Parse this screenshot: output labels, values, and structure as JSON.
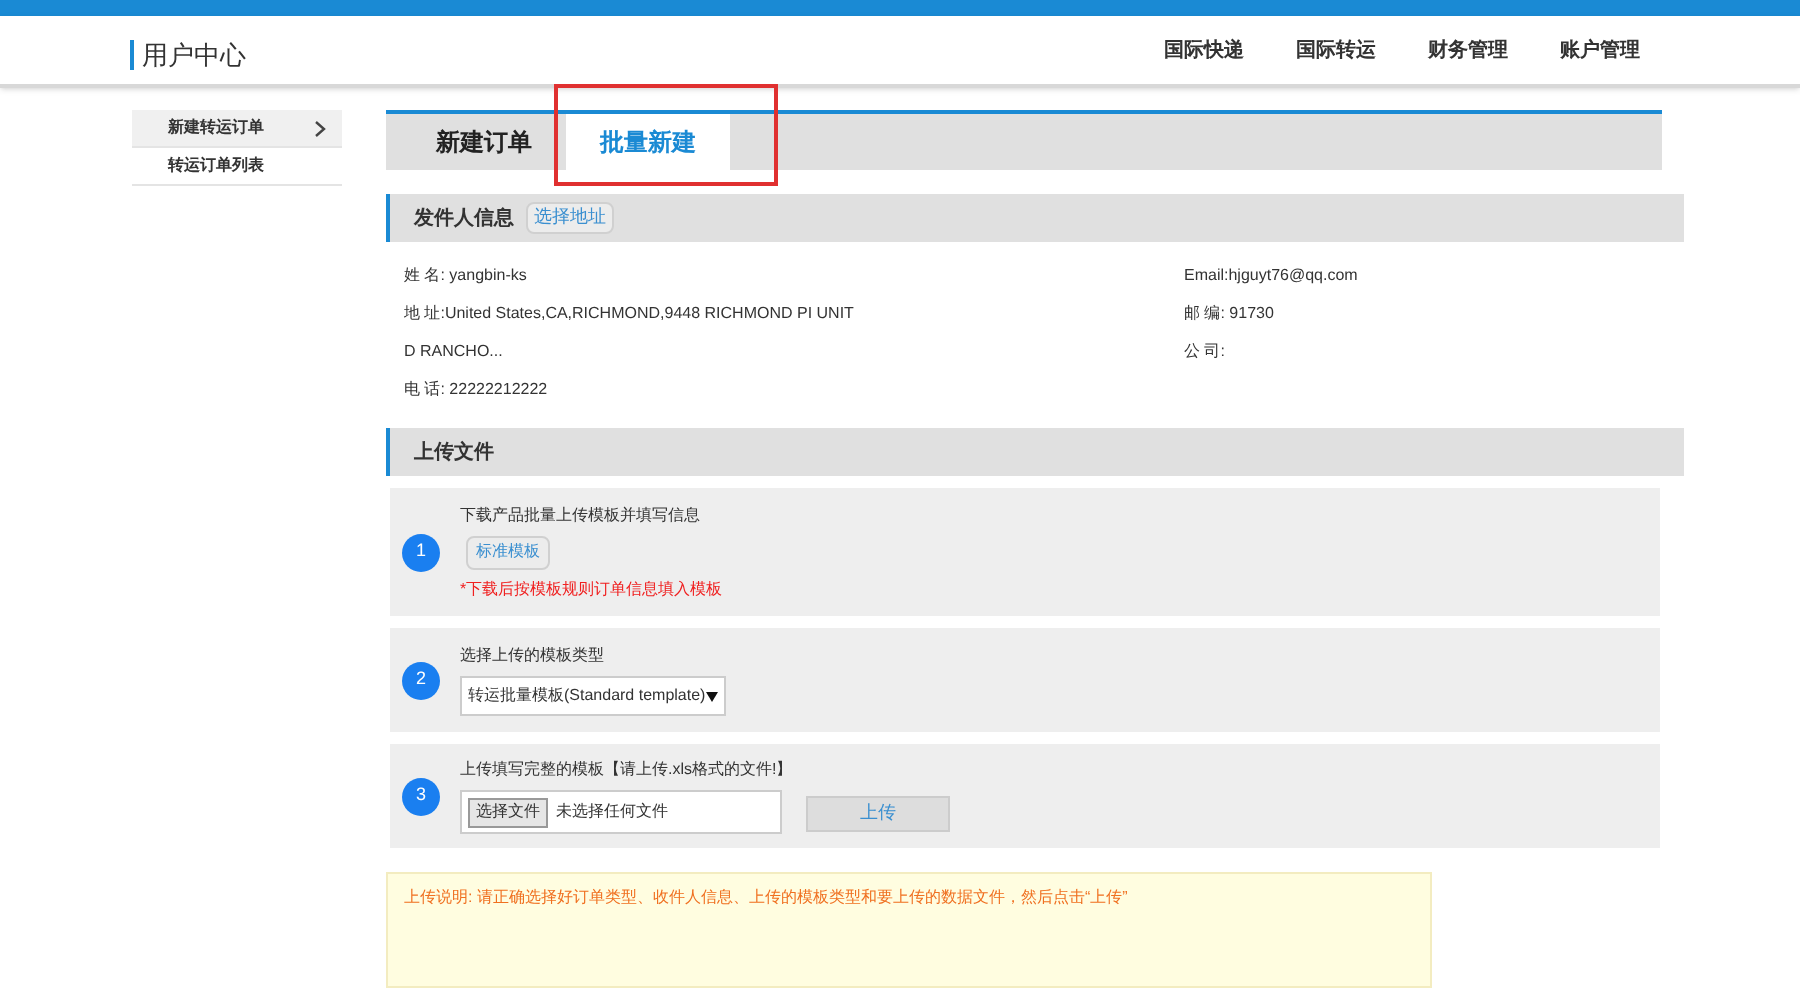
{
  "header": {
    "title": "用户中心",
    "nav": [
      "国际快递",
      "国际转运",
      "财务管理",
      "账户管理"
    ]
  },
  "sidebar": {
    "items": [
      {
        "label": "新建转运订单",
        "selected": true,
        "has_arrow": true
      },
      {
        "label": "转运订单列表",
        "selected": false,
        "has_arrow": false
      }
    ]
  },
  "tabs": [
    {
      "label": "新建订单",
      "selected": false
    },
    {
      "label": "批量新建",
      "selected": true,
      "highlighted": true
    }
  ],
  "sender": {
    "title": "发件人信息",
    "action": "选择地址",
    "left": [
      "姓 名: yangbin-ks",
      "地 址:United States,CA,RICHMOND,9448 RICHMOND PI UNIT",
      "D RANCHO...",
      "电 话: 22222212222"
    ],
    "right": [
      "Email:hjguyt76@qq.com",
      "邮 编: 91730",
      "公 司:"
    ]
  },
  "upload": {
    "title": "上传文件",
    "steps": [
      {
        "kind": "download",
        "number": "1",
        "label": "下载产品批量上传模板并填写信息",
        "button": "标准模板",
        "hint": "*下载后按模板规则订单信息填入模板"
      },
      {
        "kind": "select",
        "number": "2",
        "label": "选择上传的模板类型",
        "value": "转运批量模板(Standard template)"
      },
      {
        "kind": "file",
        "number": "3",
        "label": "上传填写完整的模板【请上传.xls格式的文件!】",
        "file_button": "选择文件",
        "file_status": "未选择任何文件",
        "submit": "上传"
      }
    ]
  },
  "note": "上传说明: 请正确选择好订单类型、收件人信息、上传的模板类型和要上传的数据文件，然后点击“上传”"
}
